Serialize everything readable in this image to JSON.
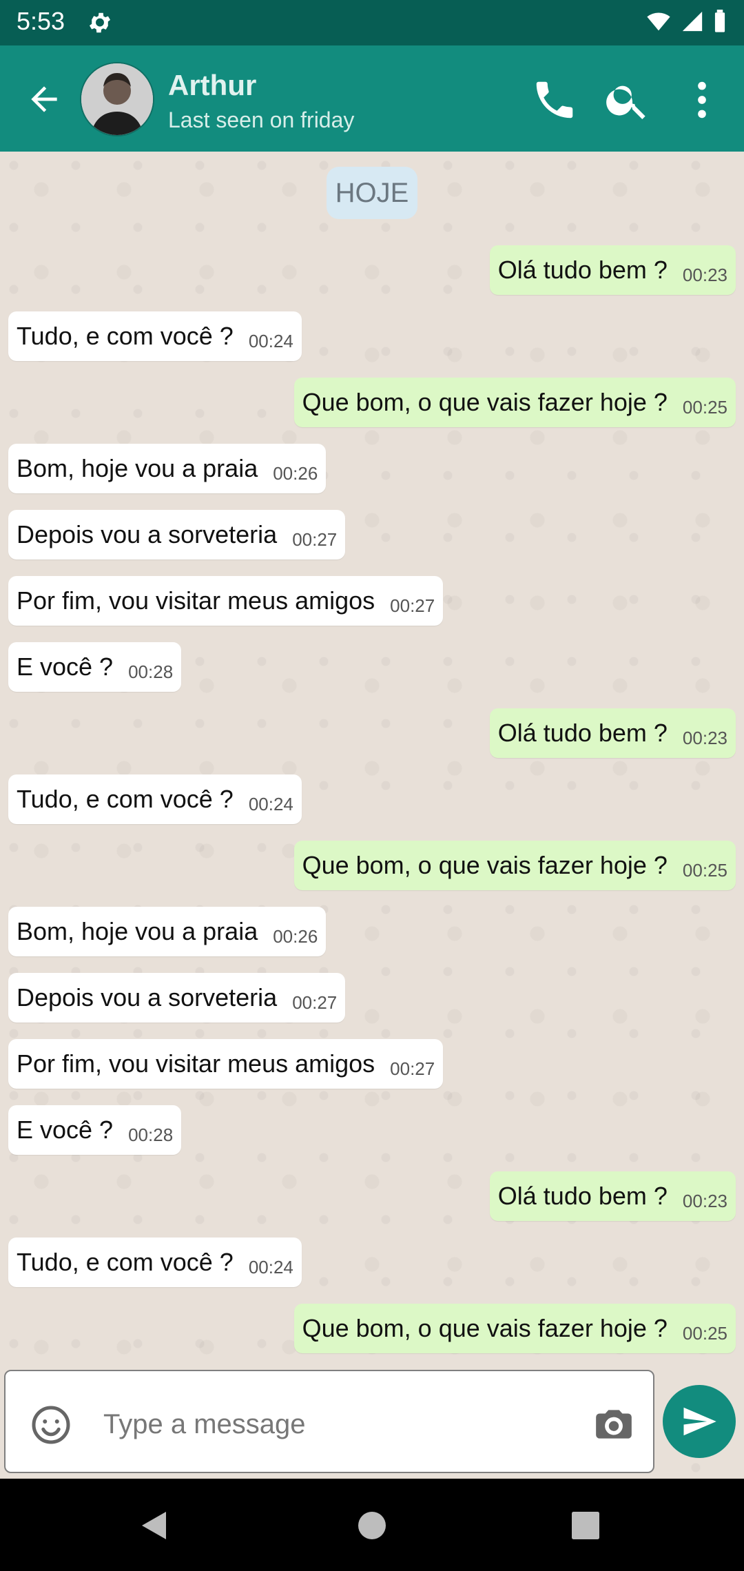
{
  "status_bar": {
    "time": "5:53"
  },
  "header": {
    "contact_name": "Arthur",
    "contact_status": "Last seen on friday"
  },
  "chat": {
    "day_label": "HOJE",
    "messages": [
      {
        "text": "Olá tudo bem ?",
        "time": "00:23",
        "direction": "out"
      },
      {
        "text": "Tudo, e com você ?",
        "time": "00:24",
        "direction": "in"
      },
      {
        "text": "Que bom, o que vais fazer hoje ?",
        "time": "00:25",
        "direction": "out"
      },
      {
        "text": "Bom, hoje vou a praia",
        "time": "00:26",
        "direction": "in"
      },
      {
        "text": "Depois vou a sorveteria",
        "time": "00:27",
        "direction": "in"
      },
      {
        "text": "Por fim, vou visitar meus amigos",
        "time": "00:27",
        "direction": "in"
      },
      {
        "text": "E você ?",
        "time": "00:28",
        "direction": "in"
      },
      {
        "text": "Olá tudo bem ?",
        "time": "00:23",
        "direction": "out"
      },
      {
        "text": "Tudo, e com você ?",
        "time": "00:24",
        "direction": "in"
      },
      {
        "text": "Que bom, o que vais fazer hoje ?",
        "time": "00:25",
        "direction": "out"
      },
      {
        "text": "Bom, hoje vou a praia",
        "time": "00:26",
        "direction": "in"
      },
      {
        "text": "Depois vou a sorveteria",
        "time": "00:27",
        "direction": "in"
      },
      {
        "text": "Por fim, vou visitar meus amigos",
        "time": "00:27",
        "direction": "in"
      },
      {
        "text": "E você ?",
        "time": "00:28",
        "direction": "in"
      },
      {
        "text": "Olá tudo bem ?",
        "time": "00:23",
        "direction": "out"
      },
      {
        "text": "Tudo, e com você ?",
        "time": "00:24",
        "direction": "in"
      },
      {
        "text": "Que bom, o que vais fazer hoje ?",
        "time": "00:25",
        "direction": "out"
      }
    ]
  },
  "composer": {
    "placeholder": "Type a message"
  },
  "icons": {
    "back": "arrow-left-icon",
    "call": "phone-icon",
    "search": "search-icon",
    "menu": "more-vert-icon",
    "emoji": "emoji-icon",
    "camera": "camera-icon",
    "send": "send-icon"
  },
  "colors": {
    "header": "#128c7e",
    "status_bar": "#075e54",
    "outgoing_bubble": "#dcf8c6",
    "incoming_bubble": "#ffffff",
    "send_button": "#128c7e"
  }
}
